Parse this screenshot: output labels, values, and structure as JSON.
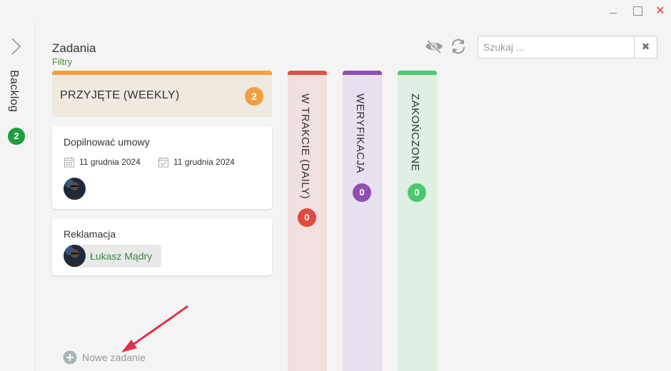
{
  "window": {
    "minimize_icon": "minimize-icon",
    "maximize_icon": "maximize-icon",
    "close_glyph": "✕"
  },
  "sidebar": {
    "label": "Backlog",
    "count": "2",
    "expand_icon": "chevron-right-icon"
  },
  "header": {
    "title": "Zadania",
    "filters_label": "Filtry"
  },
  "toolbar": {
    "visibility_icon": "eye-icon",
    "refresh_icon": "refresh-icon",
    "search_placeholder": "Szukaj ...",
    "search_value": "",
    "clear_glyph": "✖"
  },
  "columns": [
    {
      "title": "PRZYJĘTE (WEEKLY)",
      "count": "2",
      "accent": "#f0a040",
      "cards": [
        {
          "title": "Dopilnować umowy",
          "start_date": "11 grudnia 2024",
          "due_date": "11 grudnia 2024"
        },
        {
          "title": "Reklamacja",
          "assignee": "Łukasz Mądry"
        }
      ],
      "new_task_label": "Nowe zadanie"
    },
    {
      "title": "W TRAKCIE (DAILY)",
      "count": "0",
      "accent": "#e05248"
    },
    {
      "title": "WERYFIKACJA",
      "count": "0",
      "accent": "#8e4fb0"
    },
    {
      "title": "ZAKOŃCZONE",
      "count": "0",
      "accent": "#4cc870"
    }
  ]
}
